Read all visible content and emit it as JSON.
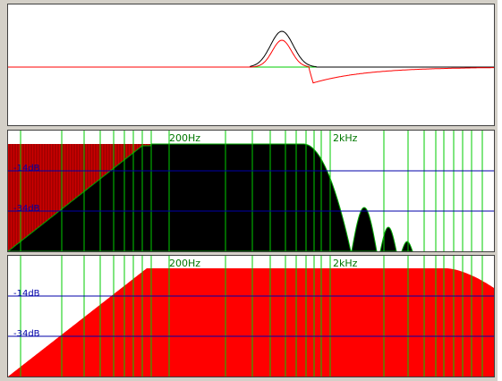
{
  "impulse": {
    "baseline_color": "#ff0000",
    "trace_colors": {
      "black": "#000000",
      "red": "#ff0000",
      "green": "#00cc00"
    }
  },
  "spectrum": {
    "freq_labels": [
      "200Hz",
      "2kHz"
    ],
    "db_labels": [
      "-14dB",
      "-34dB"
    ],
    "colors": {
      "gridline_vertical": "#00cc00",
      "gridline_horizontal": "#0000aa",
      "fill_main": "#000000",
      "fill_background": "#cc0000",
      "label_freq": "#007700",
      "label_db": "#0000aa"
    }
  },
  "response": {
    "freq_labels": [
      "200Hz",
      "2kHz"
    ],
    "db_labels": [
      "-14dB",
      "-34dB"
    ],
    "colors": {
      "gridline_vertical": "#00cc00",
      "gridline_horizontal": "#0000aa",
      "fill_main": "#ff0000",
      "label_freq": "#007700",
      "label_db": "#0000aa"
    }
  }
}
